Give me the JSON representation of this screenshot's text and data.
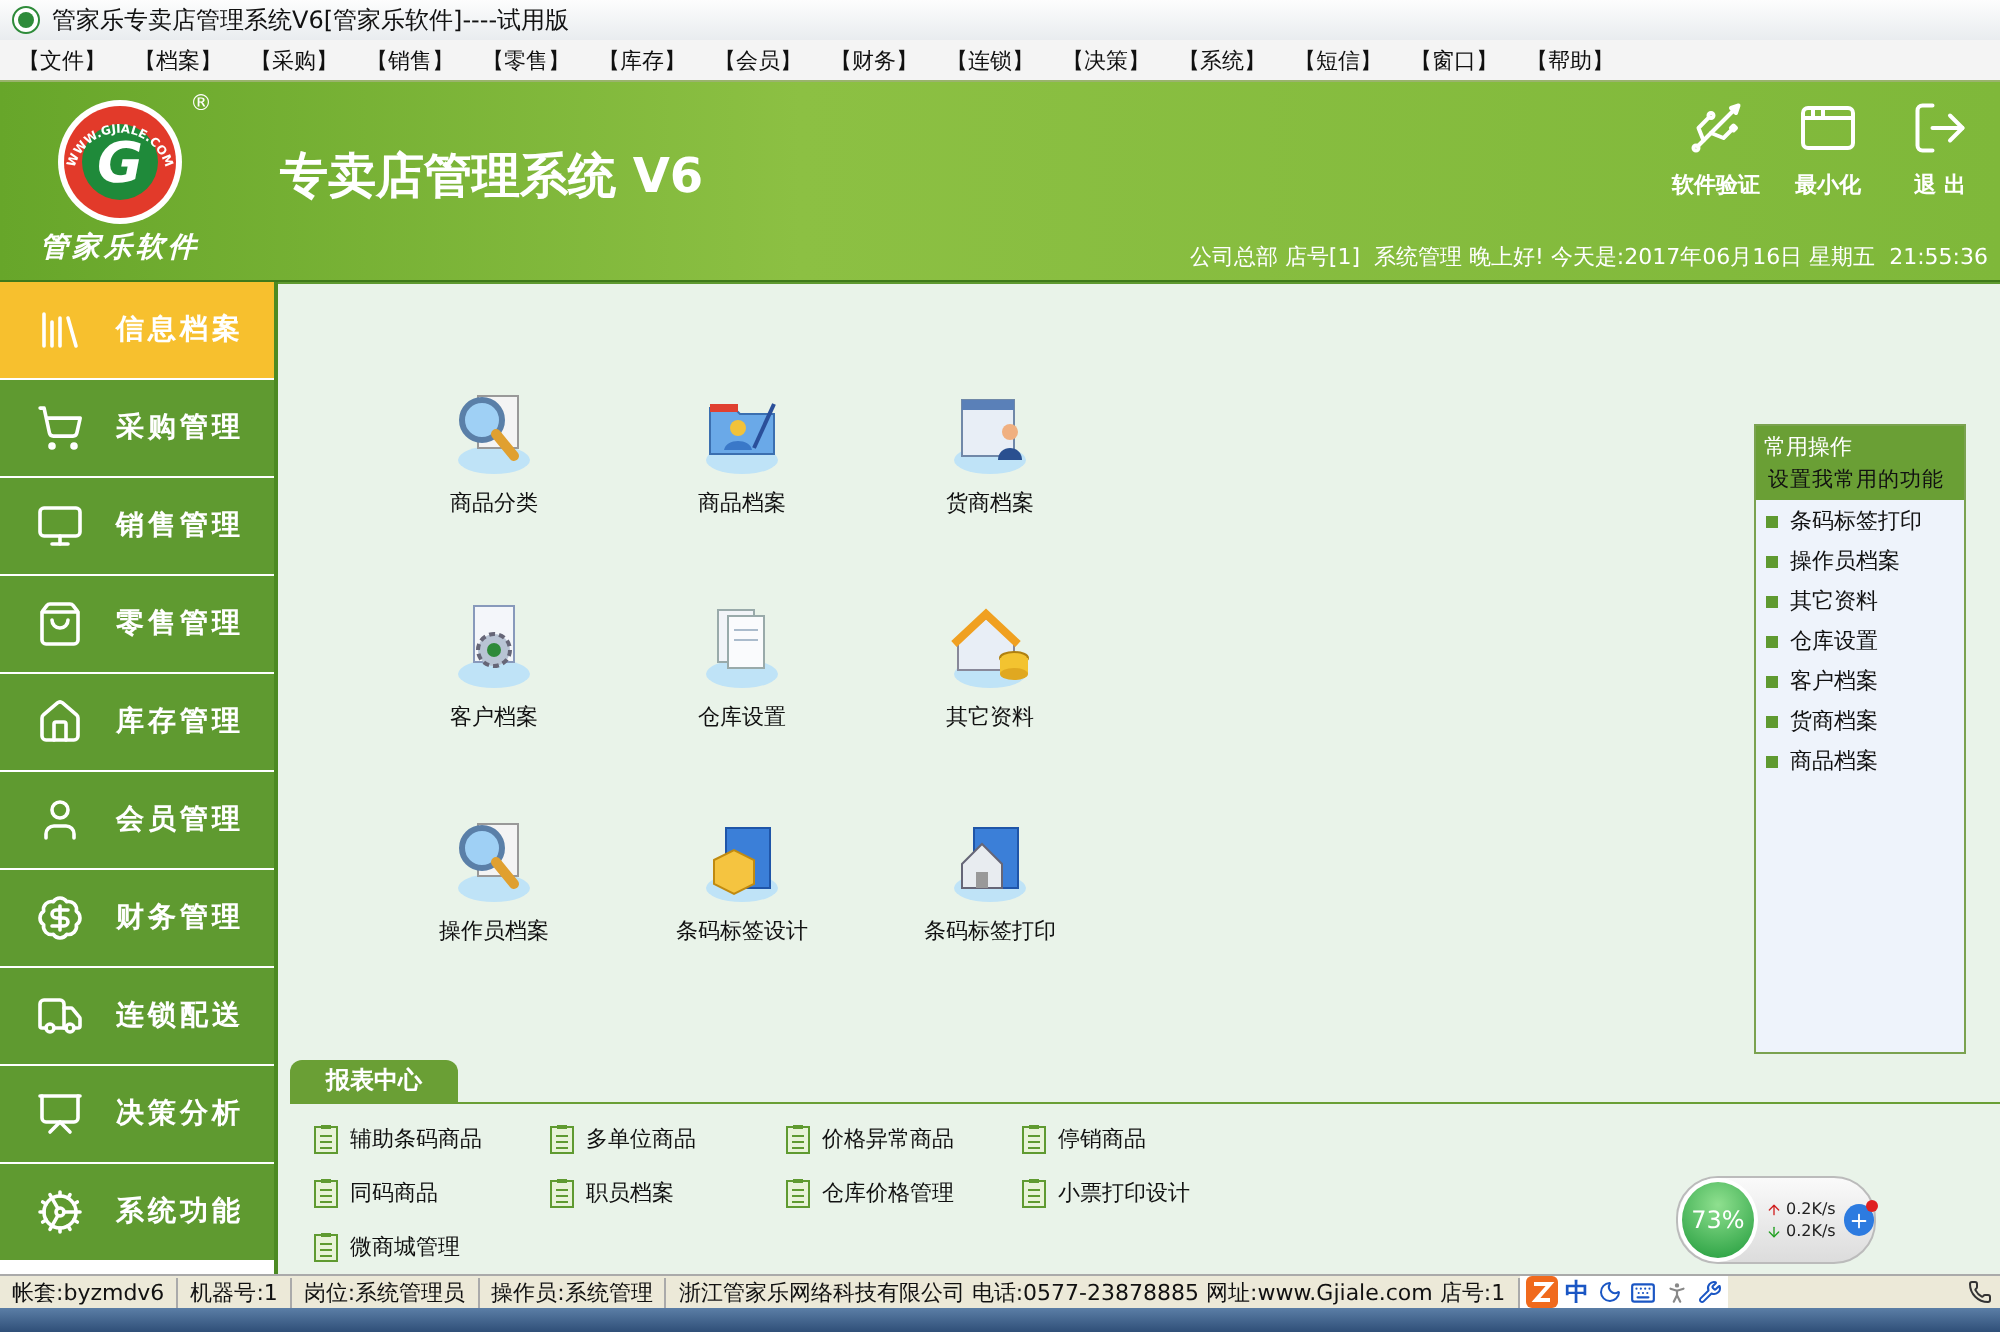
{
  "window": {
    "title": "管家乐专卖店管理系统V6[管家乐软件]----试用版"
  },
  "menu": [
    "【文件】",
    "【档案】",
    "【采购】",
    "【销售】",
    "【零售】",
    "【库存】",
    "【会员】",
    "【财务】",
    "【连锁】",
    "【决策】",
    "【系统】",
    "【短信】",
    "【窗口】",
    "【帮助】"
  ],
  "header": {
    "logo": {
      "mark": "G",
      "registered": "®",
      "ring_text": "WWW.GJIALE.COM",
      "name": "管家乐软件"
    },
    "app_title": "专卖店管理系统 V6",
    "buttons": [
      "软件验证",
      "最小化",
      "退 出"
    ],
    "info": "公司总部 店号[1]  系统管理 晚上好! 今天是:2017年06月16日 星期五  21:55:36"
  },
  "sidebar": {
    "items": [
      {
        "label": "信息档案",
        "selected": true
      },
      {
        "label": "采购管理",
        "selected": false
      },
      {
        "label": "销售管理",
        "selected": false
      },
      {
        "label": "零售管理",
        "selected": false
      },
      {
        "label": "库存管理",
        "selected": false
      },
      {
        "label": "会员管理",
        "selected": false
      },
      {
        "label": "财务管理",
        "selected": false
      },
      {
        "label": "连锁配送",
        "selected": false
      },
      {
        "label": "决策分析",
        "selected": false
      },
      {
        "label": "系统功能",
        "selected": false
      }
    ]
  },
  "modules": [
    "商品分类",
    "商品档案",
    "货商档案",
    "客户档案",
    "仓库设置",
    "其它资料",
    "操作员档案",
    "条码标签设计",
    "条码标签打印"
  ],
  "quick_panel": {
    "title": "常用操作",
    "subtitle": "设置我常用的功能",
    "items": [
      "条码标签打印",
      "操作员档案",
      "其它资料",
      "仓库设置",
      "客户档案",
      "货商档案",
      "商品档案"
    ]
  },
  "reports": {
    "title": "报表中心",
    "items": [
      "辅助条码商品",
      "多单位商品",
      "价格异常商品",
      "停销商品",
      "同码商品",
      "职员档案",
      "仓库价格管理",
      "小票打印设计",
      "微商城管理"
    ]
  },
  "net_widget": {
    "percent": "73%",
    "up": "0.2K/s",
    "down": "0.2K/s"
  },
  "status_bar": {
    "fields": [
      "帐套:byzmdv6",
      "机器号:1",
      "岗位:系统管理员",
      "操作员:系统管理",
      "浙江管家乐网络科技有限公司 电话:0577-23878885 网址:www.Gjiale.com 店号:1"
    ],
    "ime": "中"
  }
}
